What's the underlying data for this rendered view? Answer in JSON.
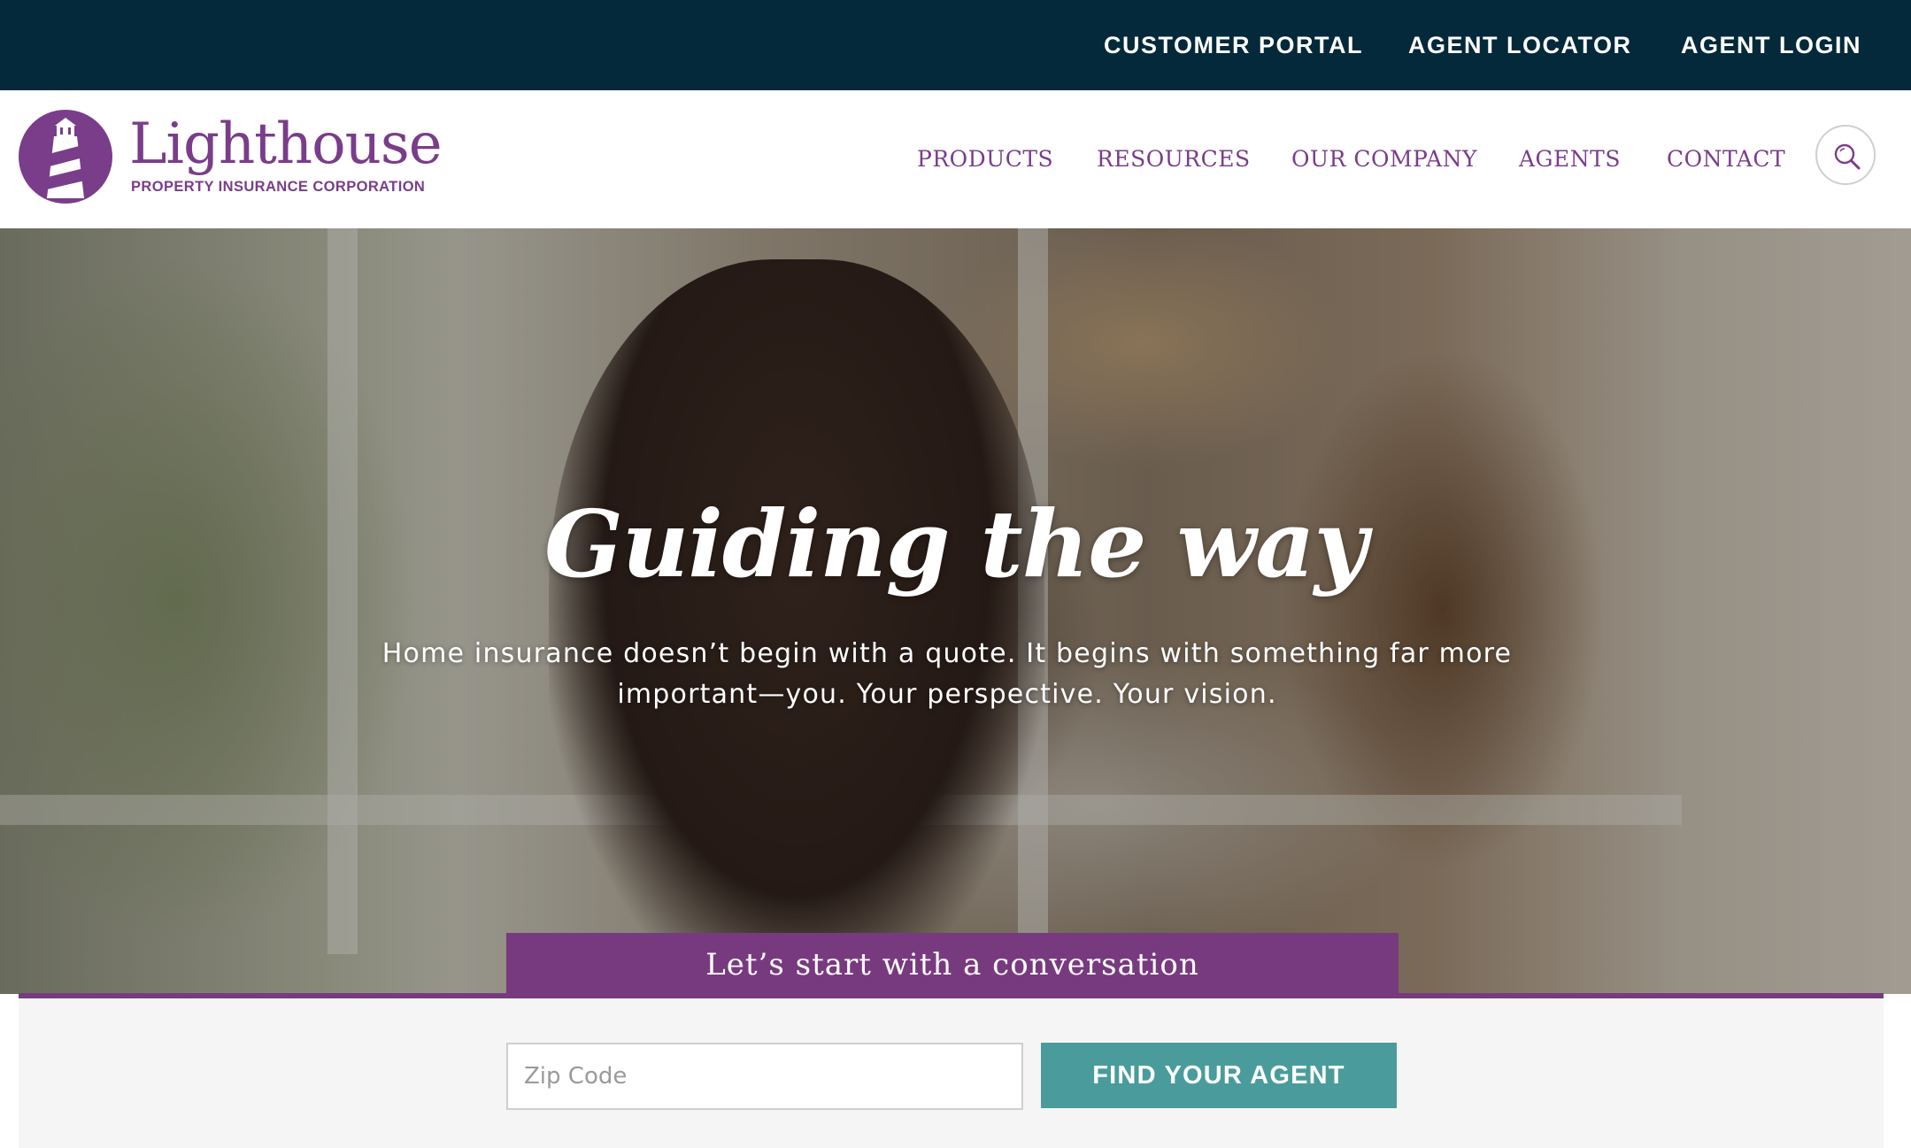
{
  "topbar": {
    "links": [
      "CUSTOMER PORTAL",
      "AGENT LOCATOR",
      "AGENT LOGIN"
    ]
  },
  "brand": {
    "name": "Lighthouse",
    "tagline": "PROPERTY INSURANCE CORPORATION",
    "logo_icon": "lighthouse-icon",
    "color": "#7a3d8a"
  },
  "nav": {
    "items": [
      "PRODUCTS",
      "RESOURCES",
      "OUR COMPANY",
      "AGENTS",
      "CONTACT"
    ],
    "search_icon": "search-icon"
  },
  "hero": {
    "title": "Guiding the way",
    "subtitle": "Home insurance doesn’t begin with a quote. It begins with something far more important—you. Your perspective. Your vision."
  },
  "agent_finder": {
    "heading": "Let’s start with a conversation",
    "zip_placeholder": "Zip Code",
    "button_label": "FIND YOUR AGENT"
  },
  "colors": {
    "topbar": "#03293a",
    "purple": "#783a7f",
    "teal": "#4a9c9c"
  }
}
